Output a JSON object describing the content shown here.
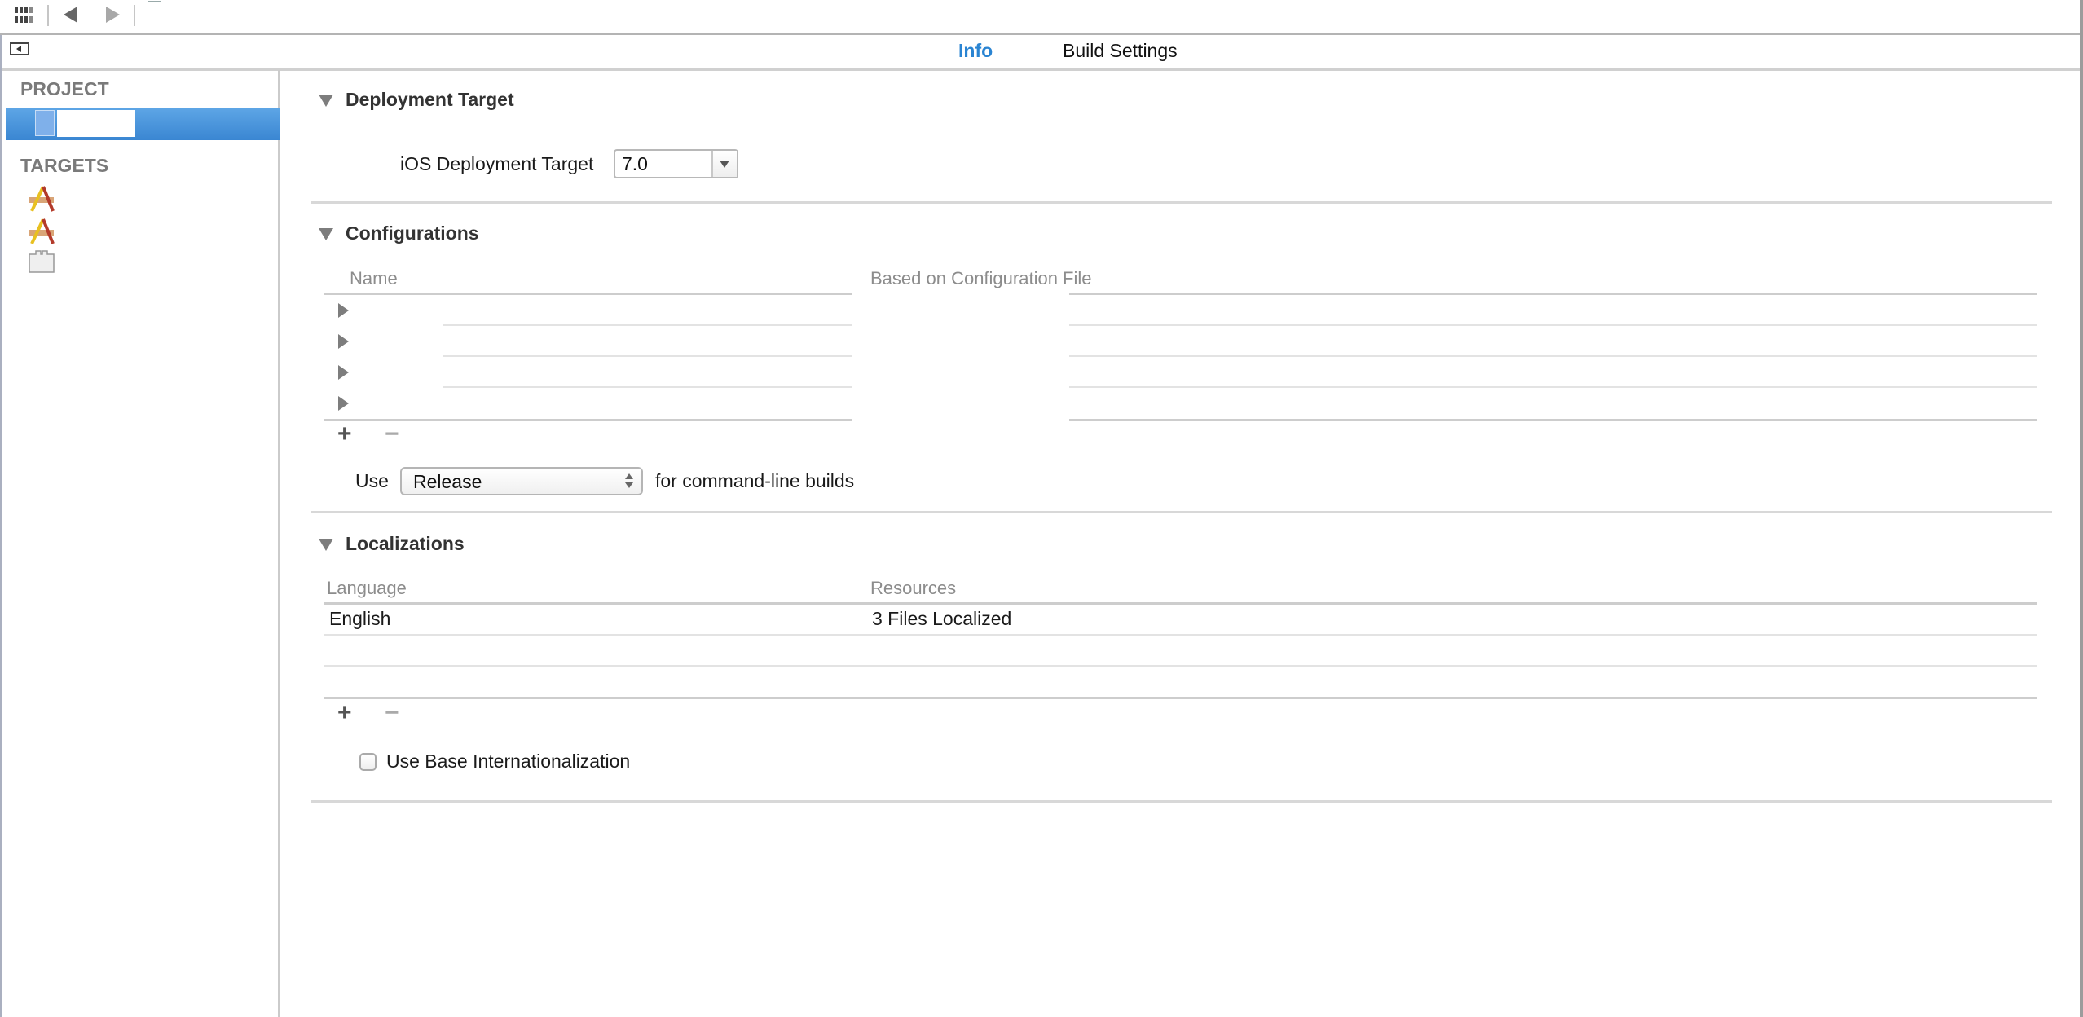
{
  "toolbar": {
    "icons": [
      "grid-icon",
      "back-arrow-icon",
      "forward-arrow-icon"
    ]
  },
  "tabbar": {
    "sidebar_toggle": "sidebar-toggle-icon",
    "tabs": [
      {
        "label": "Info",
        "active": true
      },
      {
        "label": "Build Settings",
        "active": false
      }
    ],
    "active_color": "#2a84d2"
  },
  "sidebar": {
    "project_header": "PROJECT",
    "project_item": {
      "name": "",
      "icon": "xcode-project-icon",
      "selected": true
    },
    "targets_header": "TARGETS",
    "targets": [
      {
        "name": "",
        "icon": "app-target-icon"
      },
      {
        "name": "",
        "icon": "app-target-icon"
      },
      {
        "name": "",
        "icon": "bundle-target-icon"
      }
    ],
    "selection_color": "#3a86d2"
  },
  "deployment": {
    "title": "Deployment Target",
    "ios_label": "iOS Deployment Target",
    "ios_value": "7.0"
  },
  "configurations": {
    "title": "Configurations",
    "columns": [
      "Name",
      "Based on Configuration File"
    ],
    "rows": [
      {
        "name": "",
        "file": ""
      },
      {
        "name": "",
        "file": ""
      },
      {
        "name": "",
        "file": ""
      },
      {
        "name": "",
        "file": ""
      }
    ],
    "add_label": "+",
    "remove_label": "−",
    "use_label": "Use",
    "command_line_config": "Release",
    "command_line_suffix": "for command-line builds"
  },
  "localizations": {
    "title": "Localizations",
    "columns": [
      "Language",
      "Resources"
    ],
    "rows": [
      {
        "language": "English",
        "resources": "3 Files Localized"
      }
    ],
    "add_label": "+",
    "remove_label": "−",
    "base_internationalization_label": "Use Base Internationalization",
    "base_internationalization_checked": false
  }
}
